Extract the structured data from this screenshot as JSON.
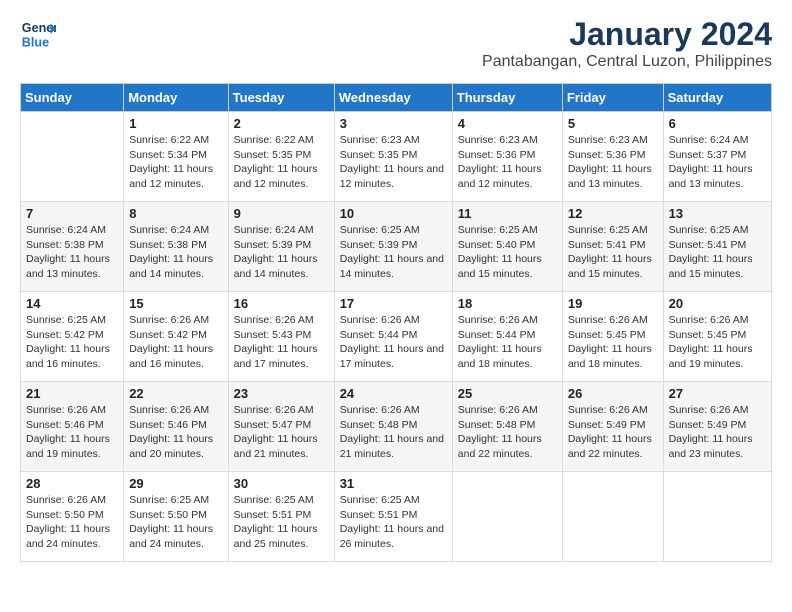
{
  "logo": {
    "line1": "General",
    "line2": "Blue"
  },
  "title": "January 2024",
  "subtitle": "Pantabangan, Central Luzon, Philippines",
  "header": {
    "accent_color": "#2176c7"
  },
  "weekdays": [
    "Sunday",
    "Monday",
    "Tuesday",
    "Wednesday",
    "Thursday",
    "Friday",
    "Saturday"
  ],
  "weeks": [
    [
      {
        "day": "",
        "sunrise": "",
        "sunset": "",
        "daylight": ""
      },
      {
        "day": "1",
        "sunrise": "Sunrise: 6:22 AM",
        "sunset": "Sunset: 5:34 PM",
        "daylight": "Daylight: 11 hours and 12 minutes."
      },
      {
        "day": "2",
        "sunrise": "Sunrise: 6:22 AM",
        "sunset": "Sunset: 5:35 PM",
        "daylight": "Daylight: 11 hours and 12 minutes."
      },
      {
        "day": "3",
        "sunrise": "Sunrise: 6:23 AM",
        "sunset": "Sunset: 5:35 PM",
        "daylight": "Daylight: 11 hours and 12 minutes."
      },
      {
        "day": "4",
        "sunrise": "Sunrise: 6:23 AM",
        "sunset": "Sunset: 5:36 PM",
        "daylight": "Daylight: 11 hours and 12 minutes."
      },
      {
        "day": "5",
        "sunrise": "Sunrise: 6:23 AM",
        "sunset": "Sunset: 5:36 PM",
        "daylight": "Daylight: 11 hours and 13 minutes."
      },
      {
        "day": "6",
        "sunrise": "Sunrise: 6:24 AM",
        "sunset": "Sunset: 5:37 PM",
        "daylight": "Daylight: 11 hours and 13 minutes."
      }
    ],
    [
      {
        "day": "7",
        "sunrise": "Sunrise: 6:24 AM",
        "sunset": "Sunset: 5:38 PM",
        "daylight": "Daylight: 11 hours and 13 minutes."
      },
      {
        "day": "8",
        "sunrise": "Sunrise: 6:24 AM",
        "sunset": "Sunset: 5:38 PM",
        "daylight": "Daylight: 11 hours and 14 minutes."
      },
      {
        "day": "9",
        "sunrise": "Sunrise: 6:24 AM",
        "sunset": "Sunset: 5:39 PM",
        "daylight": "Daylight: 11 hours and 14 minutes."
      },
      {
        "day": "10",
        "sunrise": "Sunrise: 6:25 AM",
        "sunset": "Sunset: 5:39 PM",
        "daylight": "Daylight: 11 hours and 14 minutes."
      },
      {
        "day": "11",
        "sunrise": "Sunrise: 6:25 AM",
        "sunset": "Sunset: 5:40 PM",
        "daylight": "Daylight: 11 hours and 15 minutes."
      },
      {
        "day": "12",
        "sunrise": "Sunrise: 6:25 AM",
        "sunset": "Sunset: 5:41 PM",
        "daylight": "Daylight: 11 hours and 15 minutes."
      },
      {
        "day": "13",
        "sunrise": "Sunrise: 6:25 AM",
        "sunset": "Sunset: 5:41 PM",
        "daylight": "Daylight: 11 hours and 15 minutes."
      }
    ],
    [
      {
        "day": "14",
        "sunrise": "Sunrise: 6:25 AM",
        "sunset": "Sunset: 5:42 PM",
        "daylight": "Daylight: 11 hours and 16 minutes."
      },
      {
        "day": "15",
        "sunrise": "Sunrise: 6:26 AM",
        "sunset": "Sunset: 5:42 PM",
        "daylight": "Daylight: 11 hours and 16 minutes."
      },
      {
        "day": "16",
        "sunrise": "Sunrise: 6:26 AM",
        "sunset": "Sunset: 5:43 PM",
        "daylight": "Daylight: 11 hours and 17 minutes."
      },
      {
        "day": "17",
        "sunrise": "Sunrise: 6:26 AM",
        "sunset": "Sunset: 5:44 PM",
        "daylight": "Daylight: 11 hours and 17 minutes."
      },
      {
        "day": "18",
        "sunrise": "Sunrise: 6:26 AM",
        "sunset": "Sunset: 5:44 PM",
        "daylight": "Daylight: 11 hours and 18 minutes."
      },
      {
        "day": "19",
        "sunrise": "Sunrise: 6:26 AM",
        "sunset": "Sunset: 5:45 PM",
        "daylight": "Daylight: 11 hours and 18 minutes."
      },
      {
        "day": "20",
        "sunrise": "Sunrise: 6:26 AM",
        "sunset": "Sunset: 5:45 PM",
        "daylight": "Daylight: 11 hours and 19 minutes."
      }
    ],
    [
      {
        "day": "21",
        "sunrise": "Sunrise: 6:26 AM",
        "sunset": "Sunset: 5:46 PM",
        "daylight": "Daylight: 11 hours and 19 minutes."
      },
      {
        "day": "22",
        "sunrise": "Sunrise: 6:26 AM",
        "sunset": "Sunset: 5:46 PM",
        "daylight": "Daylight: 11 hours and 20 minutes."
      },
      {
        "day": "23",
        "sunrise": "Sunrise: 6:26 AM",
        "sunset": "Sunset: 5:47 PM",
        "daylight": "Daylight: 11 hours and 21 minutes."
      },
      {
        "day": "24",
        "sunrise": "Sunrise: 6:26 AM",
        "sunset": "Sunset: 5:48 PM",
        "daylight": "Daylight: 11 hours and 21 minutes."
      },
      {
        "day": "25",
        "sunrise": "Sunrise: 6:26 AM",
        "sunset": "Sunset: 5:48 PM",
        "daylight": "Daylight: 11 hours and 22 minutes."
      },
      {
        "day": "26",
        "sunrise": "Sunrise: 6:26 AM",
        "sunset": "Sunset: 5:49 PM",
        "daylight": "Daylight: 11 hours and 22 minutes."
      },
      {
        "day": "27",
        "sunrise": "Sunrise: 6:26 AM",
        "sunset": "Sunset: 5:49 PM",
        "daylight": "Daylight: 11 hours and 23 minutes."
      }
    ],
    [
      {
        "day": "28",
        "sunrise": "Sunrise: 6:26 AM",
        "sunset": "Sunset: 5:50 PM",
        "daylight": "Daylight: 11 hours and 24 minutes."
      },
      {
        "day": "29",
        "sunrise": "Sunrise: 6:25 AM",
        "sunset": "Sunset: 5:50 PM",
        "daylight": "Daylight: 11 hours and 24 minutes."
      },
      {
        "day": "30",
        "sunrise": "Sunrise: 6:25 AM",
        "sunset": "Sunset: 5:51 PM",
        "daylight": "Daylight: 11 hours and 25 minutes."
      },
      {
        "day": "31",
        "sunrise": "Sunrise: 6:25 AM",
        "sunset": "Sunset: 5:51 PM",
        "daylight": "Daylight: 11 hours and 26 minutes."
      },
      {
        "day": "",
        "sunrise": "",
        "sunset": "",
        "daylight": ""
      },
      {
        "day": "",
        "sunrise": "",
        "sunset": "",
        "daylight": ""
      },
      {
        "day": "",
        "sunrise": "",
        "sunset": "",
        "daylight": ""
      }
    ]
  ]
}
